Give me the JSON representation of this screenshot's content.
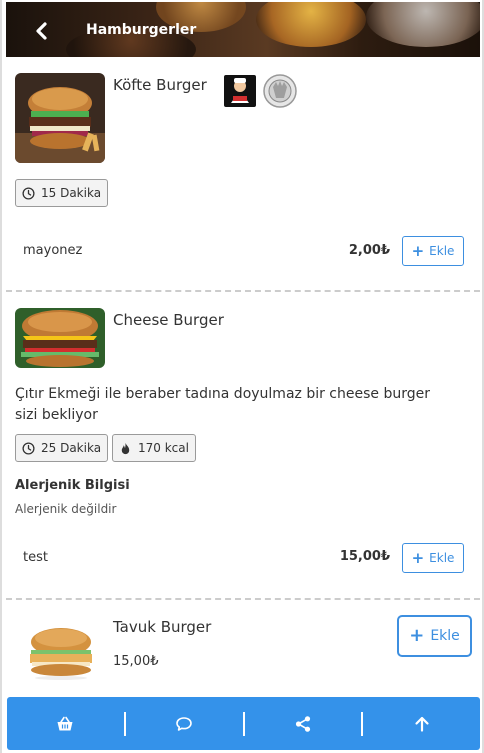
{
  "header": {
    "title": "Hamburgerler"
  },
  "products": [
    {
      "name": "Köfte Burger",
      "badges": [
        "15 Dakika"
      ],
      "options": [
        {
          "name": "mayonez",
          "price": "2,00₺",
          "button": "Ekle"
        }
      ]
    },
    {
      "name": "Cheese Burger",
      "description": "Çıtır Ekmeği ile beraber tadına doyulmaz bir cheese burger sizi bekliyor",
      "badges": [
        "25 Dakika",
        "170 kcal"
      ],
      "allergen_title": "Alerjenik Bilgisi",
      "allergen_text": "Alerjenik değildir",
      "options": [
        {
          "name": "test",
          "price": "15,00₺",
          "button": "Ekle"
        }
      ]
    },
    {
      "name": "Tavuk Burger",
      "price": "15,00₺",
      "button": "Ekle"
    }
  ],
  "bottom_bar": {
    "items": [
      "basket-icon",
      "comment-icon",
      "share-icon",
      "arrow-up-icon"
    ],
    "color": "#3492ea"
  }
}
